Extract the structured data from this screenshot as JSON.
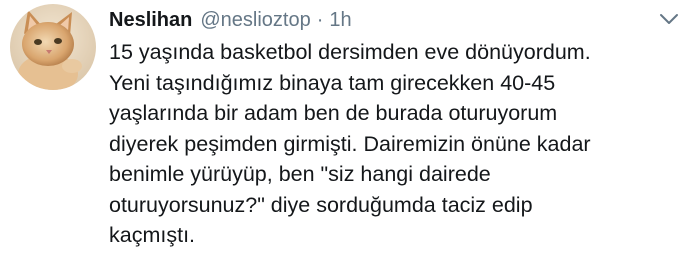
{
  "tweet": {
    "author": {
      "display_name": "Neslihan",
      "handle": "@neslioztop",
      "avatar_icon": "cat-avatar-icon"
    },
    "separator": "·",
    "time": "1h",
    "menu_icon": "chevron-down-icon",
    "text_lines": [
      "15 yaşında basketbol dersimden eve dönüyordum.",
      "Yeni taşındığımız binaya tam girecekken 40-45",
      "yaşlarında bir adam ben de burada oturuyorum",
      "diyerek peşimden girmişti. Dairemizin önüne kadar",
      "benimle yürüyüp, ben \"siz hangi dairede",
      "oturuyorsunuz?\" diye sorduğumda taciz edip",
      "kaçmıştı."
    ]
  },
  "colors": {
    "text_primary": "#14171a",
    "text_secondary": "#657786",
    "background": "#ffffff"
  }
}
